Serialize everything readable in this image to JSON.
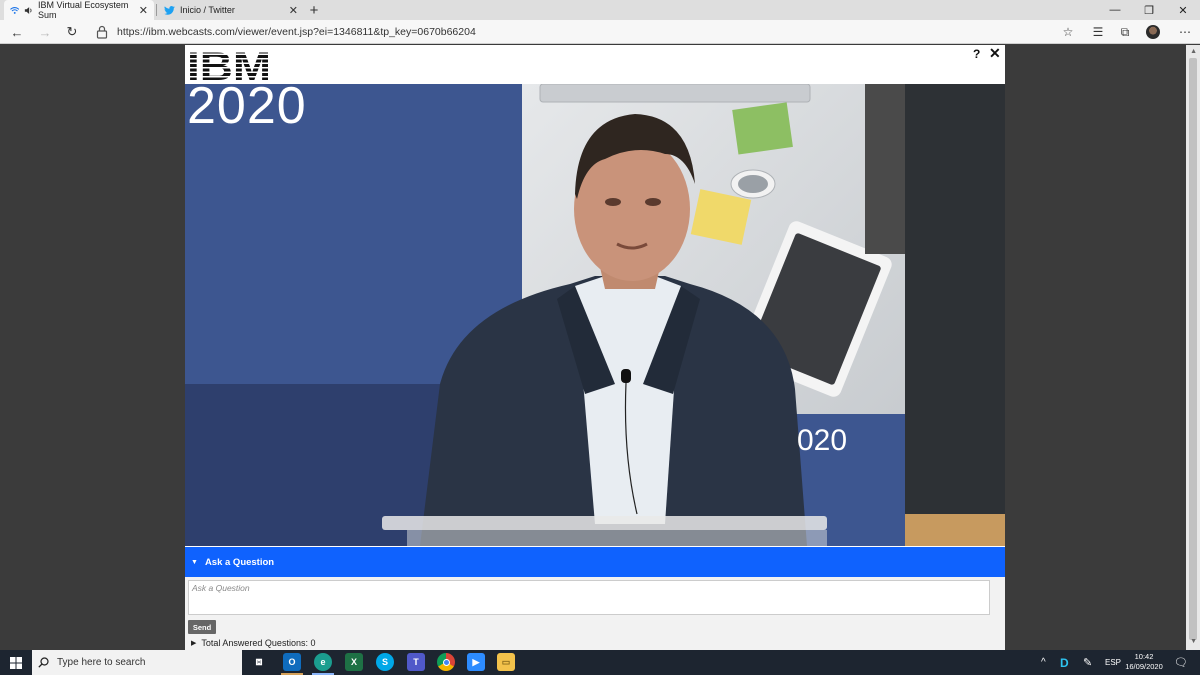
{
  "browser": {
    "tabs": [
      {
        "title": "IBM Virtual Ecosystem Sum",
        "active": true
      },
      {
        "title": "Inicio / Twitter",
        "active": false
      }
    ],
    "url": "https://ibm.webcasts.com/viewer/event.jsp?ei=1346811&tp_key=0670b66204"
  },
  "viewer": {
    "logo_text": "IBM",
    "help_label": "?",
    "close_label": "✕",
    "slide_year_top": "2020",
    "slide_year_bottom": "020",
    "ask_header": "Ask a Question",
    "ask_placeholder": "Ask a Question",
    "send_label": "Send",
    "answered_label": "Total Answered Questions: 0"
  },
  "taskbar": {
    "search_placeholder": "Type here to search",
    "language": "ESP",
    "time": "10:42",
    "date": "16/09/2020"
  },
  "colors": {
    "accent": "#0f62fe",
    "slide_background": "#3d5690"
  }
}
